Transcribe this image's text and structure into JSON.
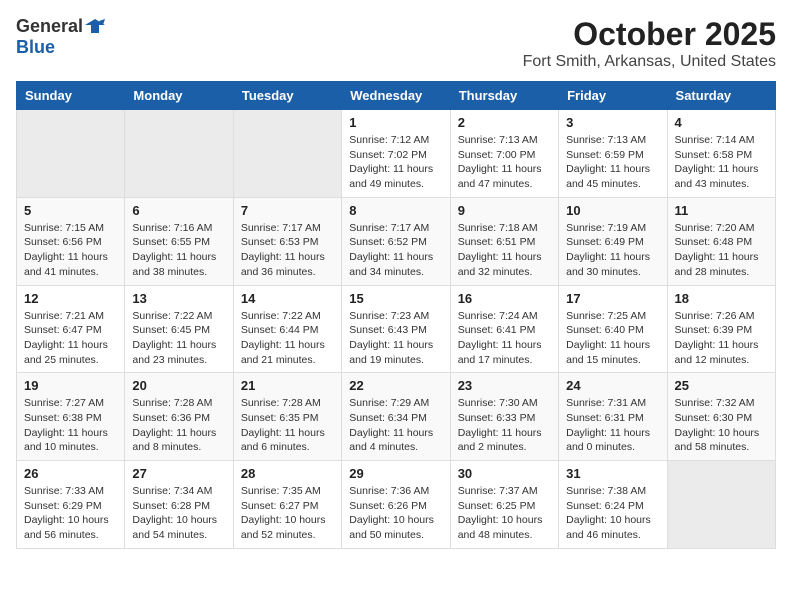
{
  "header": {
    "logo_general": "General",
    "logo_blue": "Blue",
    "month": "October 2025",
    "location": "Fort Smith, Arkansas, United States"
  },
  "weekdays": [
    "Sunday",
    "Monday",
    "Tuesday",
    "Wednesday",
    "Thursday",
    "Friday",
    "Saturday"
  ],
  "weeks": [
    [
      {
        "day": "",
        "info": ""
      },
      {
        "day": "",
        "info": ""
      },
      {
        "day": "",
        "info": ""
      },
      {
        "day": "1",
        "info": "Sunrise: 7:12 AM\nSunset: 7:02 PM\nDaylight: 11 hours\nand 49 minutes."
      },
      {
        "day": "2",
        "info": "Sunrise: 7:13 AM\nSunset: 7:00 PM\nDaylight: 11 hours\nand 47 minutes."
      },
      {
        "day": "3",
        "info": "Sunrise: 7:13 AM\nSunset: 6:59 PM\nDaylight: 11 hours\nand 45 minutes."
      },
      {
        "day": "4",
        "info": "Sunrise: 7:14 AM\nSunset: 6:58 PM\nDaylight: 11 hours\nand 43 minutes."
      }
    ],
    [
      {
        "day": "5",
        "info": "Sunrise: 7:15 AM\nSunset: 6:56 PM\nDaylight: 11 hours\nand 41 minutes."
      },
      {
        "day": "6",
        "info": "Sunrise: 7:16 AM\nSunset: 6:55 PM\nDaylight: 11 hours\nand 38 minutes."
      },
      {
        "day": "7",
        "info": "Sunrise: 7:17 AM\nSunset: 6:53 PM\nDaylight: 11 hours\nand 36 minutes."
      },
      {
        "day": "8",
        "info": "Sunrise: 7:17 AM\nSunset: 6:52 PM\nDaylight: 11 hours\nand 34 minutes."
      },
      {
        "day": "9",
        "info": "Sunrise: 7:18 AM\nSunset: 6:51 PM\nDaylight: 11 hours\nand 32 minutes."
      },
      {
        "day": "10",
        "info": "Sunrise: 7:19 AM\nSunset: 6:49 PM\nDaylight: 11 hours\nand 30 minutes."
      },
      {
        "day": "11",
        "info": "Sunrise: 7:20 AM\nSunset: 6:48 PM\nDaylight: 11 hours\nand 28 minutes."
      }
    ],
    [
      {
        "day": "12",
        "info": "Sunrise: 7:21 AM\nSunset: 6:47 PM\nDaylight: 11 hours\nand 25 minutes."
      },
      {
        "day": "13",
        "info": "Sunrise: 7:22 AM\nSunset: 6:45 PM\nDaylight: 11 hours\nand 23 minutes."
      },
      {
        "day": "14",
        "info": "Sunrise: 7:22 AM\nSunset: 6:44 PM\nDaylight: 11 hours\nand 21 minutes."
      },
      {
        "day": "15",
        "info": "Sunrise: 7:23 AM\nSunset: 6:43 PM\nDaylight: 11 hours\nand 19 minutes."
      },
      {
        "day": "16",
        "info": "Sunrise: 7:24 AM\nSunset: 6:41 PM\nDaylight: 11 hours\nand 17 minutes."
      },
      {
        "day": "17",
        "info": "Sunrise: 7:25 AM\nSunset: 6:40 PM\nDaylight: 11 hours\nand 15 minutes."
      },
      {
        "day": "18",
        "info": "Sunrise: 7:26 AM\nSunset: 6:39 PM\nDaylight: 11 hours\nand 12 minutes."
      }
    ],
    [
      {
        "day": "19",
        "info": "Sunrise: 7:27 AM\nSunset: 6:38 PM\nDaylight: 11 hours\nand 10 minutes."
      },
      {
        "day": "20",
        "info": "Sunrise: 7:28 AM\nSunset: 6:36 PM\nDaylight: 11 hours\nand 8 minutes."
      },
      {
        "day": "21",
        "info": "Sunrise: 7:28 AM\nSunset: 6:35 PM\nDaylight: 11 hours\nand 6 minutes."
      },
      {
        "day": "22",
        "info": "Sunrise: 7:29 AM\nSunset: 6:34 PM\nDaylight: 11 hours\nand 4 minutes."
      },
      {
        "day": "23",
        "info": "Sunrise: 7:30 AM\nSunset: 6:33 PM\nDaylight: 11 hours\nand 2 minutes."
      },
      {
        "day": "24",
        "info": "Sunrise: 7:31 AM\nSunset: 6:31 PM\nDaylight: 11 hours\nand 0 minutes."
      },
      {
        "day": "25",
        "info": "Sunrise: 7:32 AM\nSunset: 6:30 PM\nDaylight: 10 hours\nand 58 minutes."
      }
    ],
    [
      {
        "day": "26",
        "info": "Sunrise: 7:33 AM\nSunset: 6:29 PM\nDaylight: 10 hours\nand 56 minutes."
      },
      {
        "day": "27",
        "info": "Sunrise: 7:34 AM\nSunset: 6:28 PM\nDaylight: 10 hours\nand 54 minutes."
      },
      {
        "day": "28",
        "info": "Sunrise: 7:35 AM\nSunset: 6:27 PM\nDaylight: 10 hours\nand 52 minutes."
      },
      {
        "day": "29",
        "info": "Sunrise: 7:36 AM\nSunset: 6:26 PM\nDaylight: 10 hours\nand 50 minutes."
      },
      {
        "day": "30",
        "info": "Sunrise: 7:37 AM\nSunset: 6:25 PM\nDaylight: 10 hours\nand 48 minutes."
      },
      {
        "day": "31",
        "info": "Sunrise: 7:38 AM\nSunset: 6:24 PM\nDaylight: 10 hours\nand 46 minutes."
      },
      {
        "day": "",
        "info": ""
      }
    ]
  ]
}
